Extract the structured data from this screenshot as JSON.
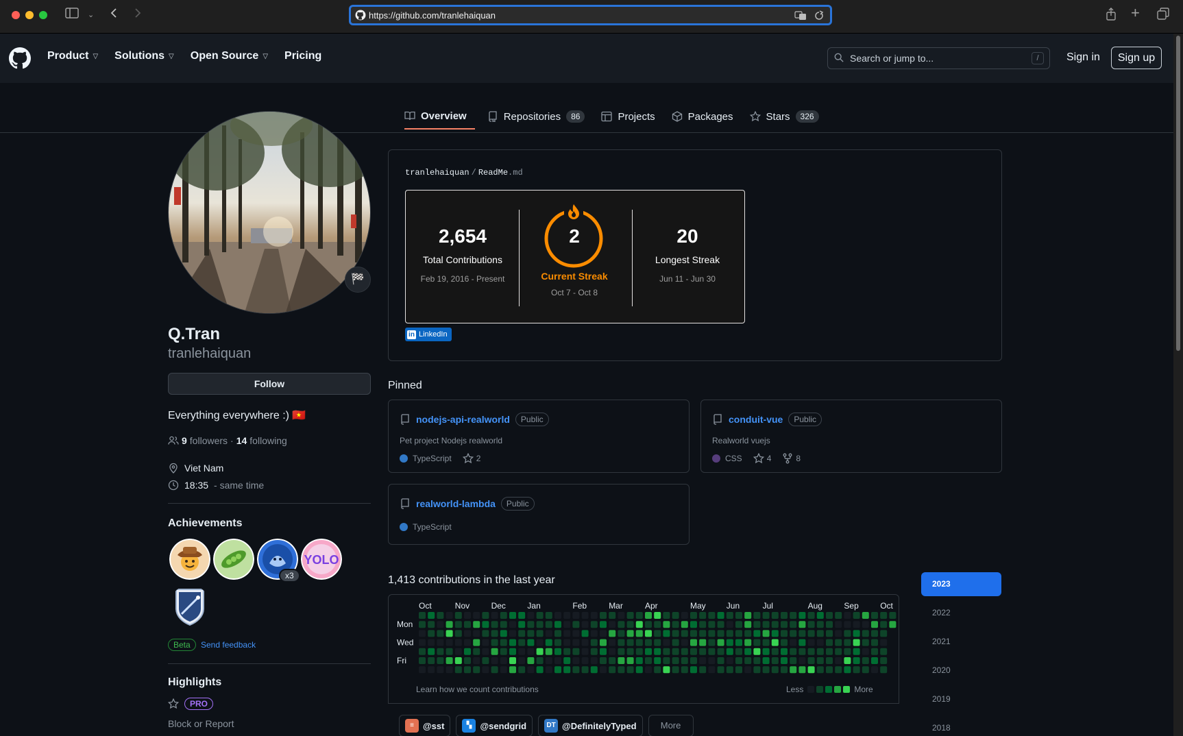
{
  "browser": {
    "url": "https://github.com/tranlehaiquan"
  },
  "header": {
    "nav": [
      {
        "label": "Product",
        "has_dropdown": true
      },
      {
        "label": "Solutions",
        "has_dropdown": true
      },
      {
        "label": "Open Source",
        "has_dropdown": true
      },
      {
        "label": "Pricing",
        "has_dropdown": false
      }
    ],
    "search_placeholder": "Search or jump to...",
    "search_shortcut": "/",
    "sign_in": "Sign in",
    "sign_up": "Sign up"
  },
  "tabs": [
    {
      "label": "Overview",
      "icon": "book-icon",
      "count": "",
      "active": true
    },
    {
      "label": "Repositories",
      "icon": "repo-icon",
      "count": "86",
      "active": false
    },
    {
      "label": "Projects",
      "icon": "table-icon",
      "count": "",
      "active": false
    },
    {
      "label": "Packages",
      "icon": "package-icon",
      "count": "",
      "active": false
    },
    {
      "label": "Stars",
      "icon": "star-icon",
      "count": "326",
      "active": false
    }
  ],
  "profile": {
    "name": "Q.Tran",
    "login": "tranlehaiquan",
    "follow_label": "Follow",
    "bio": "Everything everywhere :) 🇻🇳",
    "followers_count": "9",
    "followers_label": "followers",
    "dot": "·",
    "following_count": "14",
    "following_label": "following",
    "location": "Viet Nam",
    "local_time": "18:35",
    "time_note": "- same time",
    "status_emoji": "🏁"
  },
  "achievements": {
    "title": "Achievements",
    "badges": [
      "pull-shark-icon",
      "pair-extraordinaire-icon",
      "quickdraw-icon",
      "yolo-icon",
      "arctic-code-vault-icon"
    ],
    "multiplier": "x3",
    "beta": "Beta",
    "feedback": "Send feedback"
  },
  "highlights": {
    "title": "Highlights",
    "pro": "PRO",
    "block_report": "Block or Report"
  },
  "readme": {
    "owner": "tranlehaiquan",
    "separator": "/",
    "file": "ReadMe",
    "ext": ".md",
    "streak": {
      "total": "2,654",
      "total_label": "Total Contributions",
      "total_range": "Feb 19, 2016 - Present",
      "current": "2",
      "current_label": "Current Streak",
      "current_range": "Oct 7 - Oct 8",
      "longest": "20",
      "longest_label": "Longest Streak",
      "longest_range": "Jun 11 - Jun 30",
      "accent_color": "#fb8c00"
    },
    "linkedin": "LinkedIn"
  },
  "pinned": {
    "title": "Pinned",
    "items": [
      {
        "name": "nodejs-api-realworld",
        "visibility": "Public",
        "description": "Pet project Nodejs realworld",
        "language": "TypeScript",
        "lang_color": "#3178c6",
        "stars": "2",
        "forks": ""
      },
      {
        "name": "conduit-vue",
        "visibility": "Public",
        "description": "Realworld vuejs",
        "language": "CSS",
        "lang_color": "#563d7c",
        "stars": "4",
        "forks": "8"
      },
      {
        "name": "realworld-lambda",
        "visibility": "Public",
        "description": "",
        "language": "TypeScript",
        "lang_color": "#3178c6",
        "stars": "",
        "forks": ""
      }
    ]
  },
  "contributions": {
    "title": "1,413 contributions in the last year",
    "months": [
      "Oct",
      "Nov",
      "Dec",
      "Jan",
      "Feb",
      "Mar",
      "Apr",
      "May",
      "Jun",
      "Jul",
      "Aug",
      "Sep",
      "Oct"
    ],
    "days": [
      "Mon",
      "Wed",
      "Fri"
    ],
    "learn": "Learn how we count contributions",
    "less": "Less",
    "more": "More",
    "level_colors": [
      "#161b22",
      "#0e4429",
      "#006d32",
      "#26a641",
      "#39d353"
    ]
  },
  "activity_orgs": [
    {
      "label": "@sst",
      "icon": "sst-icon",
      "color": "#e27152",
      "abbr": ""
    },
    {
      "label": "@sendgrid",
      "icon": "sendgrid-icon",
      "color": "#1a82e2",
      "abbr": ""
    },
    {
      "label": "@DefinitelyTyped",
      "icon": "definitelytyped-icon",
      "color": "#3178c6",
      "abbr": "DT"
    }
  ],
  "activity_more": "More",
  "years": [
    "2023",
    "2022",
    "2021",
    "2020",
    "2019",
    "2018"
  ]
}
